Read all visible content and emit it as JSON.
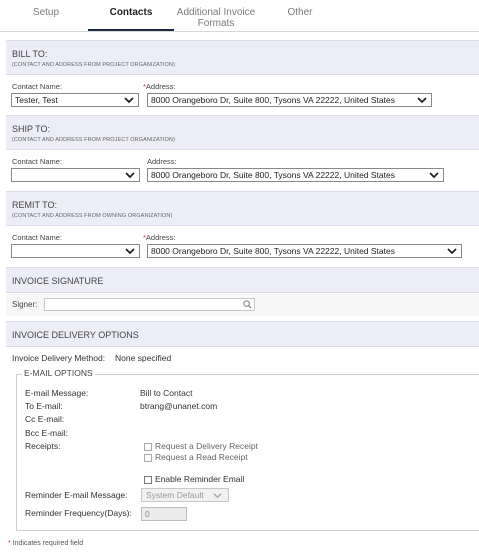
{
  "tabs": [
    {
      "label": "Setup"
    },
    {
      "label": "Contacts"
    },
    {
      "label": "Additional Invoice\nFormats"
    },
    {
      "label": "Other"
    }
  ],
  "bill_to": {
    "title": "BILL TO:",
    "subtitle": "(CONTACT AND ADDRESS FROM PROJECT ORGANIZATION)",
    "contact_label": "Contact Name:",
    "contact_value": "Tester, Test",
    "address_label": "Address:",
    "address_value": "8000 Orangeboro Dr, Suite 800, Tysons VA 22222, United States"
  },
  "ship_to": {
    "title": "SHIP TO:",
    "subtitle": "(CONTACT AND ADDRESS FROM PROJECT ORGANIZATION)",
    "contact_label": "Contact Name:",
    "contact_value": "",
    "address_label": "Address:",
    "address_value": "8000 Orangeboro Dr, Suite 800, Tysons VA 22222, United States"
  },
  "remit_to": {
    "title": "REMIT TO:",
    "subtitle": "(CONTACT AND ADDRESS FROM OWNING ORGANIZATION)",
    "contact_label": "Contact Name:",
    "contact_value": "",
    "address_label": "Address:",
    "address_value": "8000 Orangeboro Dr, Suite 800, Tysons VA 22222, United States"
  },
  "signature": {
    "title": "INVOICE SIGNATURE",
    "signer_label": "Signer:",
    "signer_value": ""
  },
  "delivery": {
    "title": "INVOICE DELIVERY OPTIONS",
    "method_label": "Invoice Delivery Method:",
    "method_value": "None specified"
  },
  "email_options": {
    "legend": "E-MAIL OPTIONS",
    "message_label": "E-mail Message:",
    "message_value": "Bill to Contact",
    "to_label": "To E-mail:",
    "to_value": "btrang@unanet.com",
    "cc_label": "Cc E-mail:",
    "bcc_label": "Bcc E-mail:",
    "receipts_label": "Receipts:",
    "delivery_receipt_label": "Request a Delivery Receipt",
    "read_receipt_label": "Request a Read Receipt",
    "reminder_email_label": "Enable Reminder Email",
    "reminder_message_label": "Reminder E-mail Message:",
    "reminder_message_value": "System Default",
    "reminder_frequency_label": "Reminder Frequency(Days):",
    "reminder_frequency_value": "0"
  },
  "footer": {
    "required_marker": "*",
    "required_note": "Indicates required field"
  },
  "colors": {
    "section_bg": "#ecedf7",
    "active_tab_underline": "#1b2a4a",
    "required": "#cc3333"
  }
}
